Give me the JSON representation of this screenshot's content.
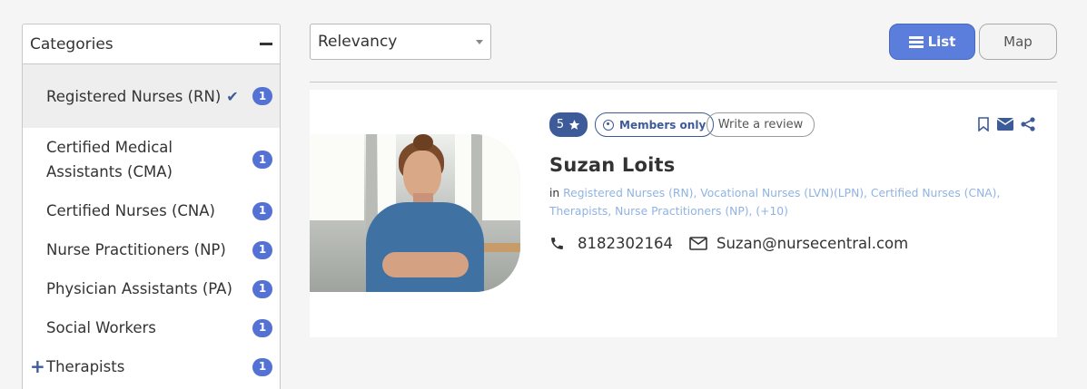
{
  "sidebar": {
    "title": "Categories",
    "items": [
      {
        "label": "Registered Nurses (RN)",
        "count": "1",
        "active": true
      },
      {
        "label": "Certified Medical Assistants (CMA)",
        "count": "1"
      },
      {
        "label": "Certified Nurses (CNA)",
        "count": "1"
      },
      {
        "label": "Nurse Practitioners (NP)",
        "count": "1"
      },
      {
        "label": "Physician Assistants (PA)",
        "count": "1"
      },
      {
        "label": "Social Workers",
        "count": "1"
      },
      {
        "label": "Therapists",
        "count": "1"
      }
    ]
  },
  "sort": {
    "selected": "Relevancy"
  },
  "view_toggle": {
    "list_label": "List",
    "map_label": "Map",
    "active": "List"
  },
  "listing": {
    "rating": "5",
    "members_label": "Members only",
    "review_label": "Write a review",
    "name": "Suzan Loits",
    "in_label": "in",
    "categories_text": "Registered Nurses (RN), Vocational Nurses (LVN)(LPN), Certified Nurses (CNA), Therapists, Nurse Practitioners (NP), (+10)",
    "phone": "8182302164",
    "email": "Suzan@nursecentral.com"
  },
  "colors": {
    "accent": "#5b7ddb",
    "badge": "#5472d3",
    "dark_blue": "#3d5a99",
    "category_link": "#90b3e3"
  },
  "icons": [
    "minus-icon",
    "check-icon",
    "plus-icon",
    "caret-down-icon",
    "list-icon",
    "star-icon",
    "user-circle-icon",
    "bookmark-icon",
    "envelope-icon",
    "share-icon",
    "phone-icon",
    "mail-icon"
  ]
}
